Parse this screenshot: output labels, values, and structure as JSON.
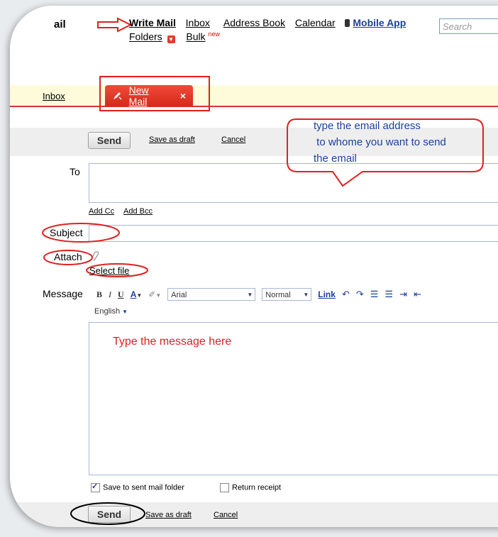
{
  "app": {
    "logo_fragment": "ail"
  },
  "topnav": {
    "write_mail": "Write Mail",
    "inbox": "Inbox",
    "address_book": "Address Book",
    "calendar": "Calendar",
    "mobile_app": "Mobile App",
    "folders": "Folders",
    "bulk": "Bulk",
    "bulk_badge": "new"
  },
  "search": {
    "placeholder": "Search"
  },
  "tabs": {
    "inbox": "Inbox",
    "new_mail": "New Mail",
    "close": "×"
  },
  "toolbar_top": {
    "send": "Send",
    "save_draft": "Save as draft",
    "cancel": "Cancel"
  },
  "form": {
    "to_label": "To",
    "add_cc": "Add Cc",
    "add_bcc": "Add Bcc",
    "subject_label": "Subject",
    "attach_label": "Attach",
    "select_file": "Select file",
    "message_label": "Message"
  },
  "editor": {
    "bold": "B",
    "italic": "I",
    "underline": "U",
    "font_color": "A",
    "font": "Arial",
    "size": "Normal",
    "link": "Link",
    "language": "English"
  },
  "options": {
    "save_sent": "Save to sent mail folder",
    "save_sent_checked": true,
    "return_receipt": "Return receipt",
    "return_receipt_checked": false
  },
  "toolbar_bottom": {
    "send": "Send",
    "save_draft": "Save as draft",
    "cancel": "Cancel"
  },
  "annotations": {
    "callout_line1": "type the email address",
    "callout_line2": " to whome you want to send",
    "callout_line3": "the email",
    "message_hint": "Type the message here"
  },
  "colors": {
    "annotation_red": "#e02020",
    "annotation_blue": "#1b3f9c",
    "accent_red": "#d33",
    "tab_red": "#e5392a"
  }
}
